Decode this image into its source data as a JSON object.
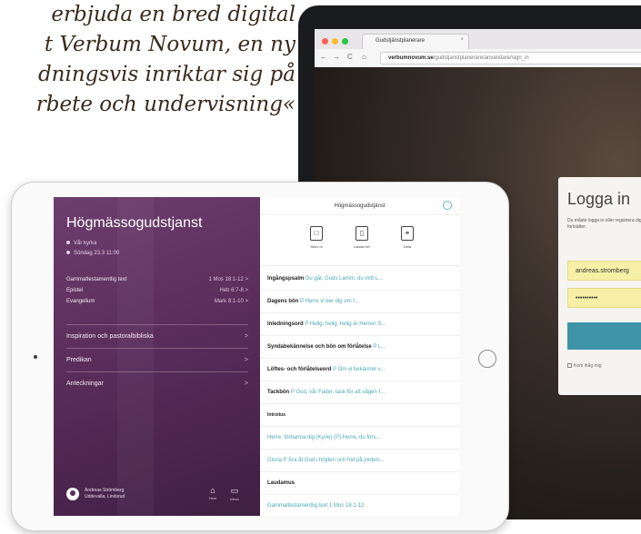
{
  "quote": {
    "lines": [
      "erbjuda en bred digital",
      "t Verbum Novum, en ny",
      "dningsvis inriktar sig på",
      "rbete och undervisning«"
    ]
  },
  "laptop": {
    "browser": {
      "tab_title": "Gudstjänstplanerare",
      "tab_close": "×",
      "back": "←",
      "forward": "→",
      "reload": "C",
      "home": "⌂",
      "url_host": "verbumnovum.se",
      "url_path": "/gudstjanstplanerare/anvandare/sign_in"
    },
    "login": {
      "title": "Logga in",
      "message": "Du måste logga in eller registrera dig innan du fortsätter.",
      "email_value": "andreas.stromberg",
      "password_value": "••••••••••",
      "remember_label": "Kom ihåg mig"
    }
  },
  "ipad": {
    "left": {
      "title": "Högmässogudstjanst",
      "location": "Vår kyrka",
      "datetime": "Söndag 23.3 11:00",
      "readings": [
        {
          "label": "Gammaltestamentlig text",
          "ref": "1 Mos 18:1-12 >"
        },
        {
          "label": "Epistel",
          "ref": "Heb 6:7-8 >"
        },
        {
          "label": "Evangelium",
          "ref": "Mark 8:1-10 >"
        }
      ],
      "menu": [
        {
          "label": "Inspiration och pastoralbibliska",
          "chev": ">"
        },
        {
          "label": "Predikan",
          "chev": ">"
        },
        {
          "label": "Anteckningar",
          "chev": ">"
        }
      ],
      "user": {
        "name": "Andreas Strömberg",
        "org": "Uddevalla, Lindsrud",
        "icons": [
          {
            "glyph": "⌂",
            "label": "Hem"
          },
          {
            "glyph": "▭",
            "label": "Inbox"
          }
        ]
      }
    },
    "right": {
      "header": "Högmässogudstjänst",
      "heart": "♡",
      "tools": [
        {
          "glyph": "□",
          "label": "Skriv ut"
        },
        {
          "glyph": "▯",
          "label": "Ladda ner"
        },
        {
          "glyph": "⚭",
          "label": "Dela"
        }
      ],
      "rows": [
        {
          "head": "Ingångspsalm",
          "text": "Du går, Guds Lamm, du mitt L..."
        },
        {
          "head": "Dagens bön",
          "text": "P Herre vi ber dig om f..."
        },
        {
          "head": "Inledningsord",
          "text": "P Helig, helig, helig är Herren S..."
        },
        {
          "head": "Syndabekännelse och bön om förlåtelse",
          "text": "P L..."
        },
        {
          "head": "Löftes- och förlåtelseord",
          "text": "P Om vi bekänner v..."
        },
        {
          "head": "Tackbön",
          "text": "P Gud, vår Fader, tack för att vågen f..."
        },
        {
          "head": "Introitus",
          "text": ""
        },
        {
          "head": "",
          "text": "Herre, förbarma dig (Kyrie) (P) Herre, du förs..."
        },
        {
          "head": "",
          "text": "Gloria P Ära åt Gud i höjden och frid på jorden..."
        },
        {
          "head": "Laudamus",
          "text": ""
        },
        {
          "head": "",
          "text": "Gammaltestamentlig text 1 Mos 18:1-12"
        }
      ]
    }
  }
}
